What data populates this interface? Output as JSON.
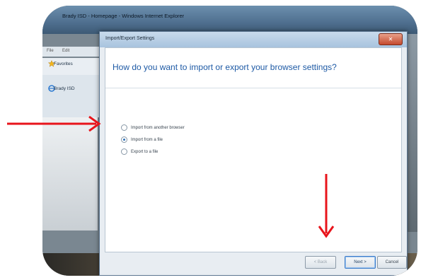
{
  "ie": {
    "title": "Brady ISD - Homepage - Windows Internet Explorer",
    "menu": [
      "File",
      "Edit"
    ],
    "favorites_label": "Favorites",
    "tab_label": "Brady ISD"
  },
  "dialog": {
    "title": "Import/Export Settings",
    "close_label": "✕",
    "heading": "How do you want to import or export your browser settings?",
    "options": [
      {
        "label": "Import from another browser",
        "checked": false
      },
      {
        "label": "Import from a file",
        "checked": true
      },
      {
        "label": "Export to a file",
        "checked": false
      }
    ],
    "buttons": {
      "back": "< Back",
      "next": "Next >",
      "cancel": "Cancel"
    }
  },
  "colors": {
    "annotation_arrow": "#e8141b",
    "heading": "#1e5aa5"
  }
}
